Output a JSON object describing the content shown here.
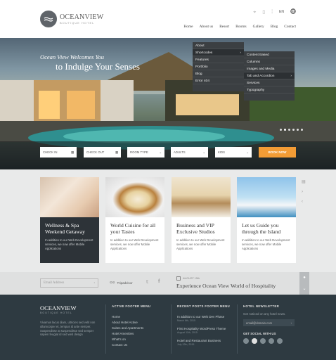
{
  "brand": {
    "name": "OCEANVIEW",
    "tagline": "BOUTIQUE HOTEL"
  },
  "topbar": {
    "icons": [
      "map-pin-icon",
      "phone-icon",
      "separator-icon"
    ],
    "lang": "EN",
    "globe": "globe-icon"
  },
  "nav": {
    "items": [
      "Home",
      "About us",
      "Resort",
      "Rooms",
      "Gallery",
      "Blog",
      "Contact"
    ]
  },
  "hero": {
    "subtitle": "Ocean View Welcomes You",
    "title": "to Indulge Your Senses",
    "slides": 6,
    "active_slide": 2
  },
  "menu": {
    "level1": [
      "About",
      "Shortcodes",
      "Features",
      "Portfolio",
      "Blog",
      "Error 404"
    ],
    "level2": [
      "Content Based",
      "Columns",
      "Images and Media",
      "Tab and Accordion",
      "Services",
      "Typography"
    ]
  },
  "booking": {
    "checkin": "CHECK IN",
    "checkout": "CHECK OUT",
    "roomtype": "ROOM TYPE",
    "adults": "ADULTS",
    "kids": "KIDS",
    "button": "BOOK NOW"
  },
  "cards": [
    {
      "title": "Wellness & Spa Weekend Getaway",
      "text": "In addition to our Web Development services, we now offer Mobile Applications"
    },
    {
      "title": "World Cuisine for all your Tastes",
      "text": "In addition to our Web Development services, we now offer Mobile Applications"
    },
    {
      "title": "Business and VIP Exclusive Studios",
      "text": "In addition to our Web Development services, we now offer Mobile Applications"
    },
    {
      "title": "Let us Guide you through the Island",
      "text": "In addition to our Web Development services, we now offer Mobile Applications"
    }
  ],
  "subscribe": {
    "placeholder": "Email Address",
    "tripadvisor": "Tripadvisor",
    "event_date": "AUGUST 15th",
    "event_title": "Experience Ocean View World of Hospitality"
  },
  "footer": {
    "brand": "OCEANVIEW",
    "tagline": "BOUTIQUE HOTEL",
    "about": "Vivamus lacus diam, ultricies sed velit non ullamcorper et, tempus id ante semper. Suspendisse at suspendisse sed semper sapien feugiat id sed web design",
    "menu_title": "ACTIVE FOOTER MENU",
    "menu": [
      "Home",
      "About Hotel Active",
      "Suites and Apartments",
      "Hotel Amenities",
      "What's on",
      "Contact Us"
    ],
    "posts_title": "RECENT POSTS FOOTER MENU",
    "posts": [
      {
        "title": "In addition to our Web Dev Phase",
        "date": "March 6th, 2015"
      },
      {
        "title": "First Hospitality WordPress Theme",
        "date": "August 11th, 2015"
      },
      {
        "title": "Hotel and Restaurant Business",
        "date": "July 12th, 2015"
      }
    ],
    "newsletter_title": "HOTEL NEWSLETTER",
    "newsletter_text": "Get noticed on any hotel news.",
    "newsletter_placeholder": "email@domain.com",
    "social_title": "GET SOCIAL WITH US"
  }
}
